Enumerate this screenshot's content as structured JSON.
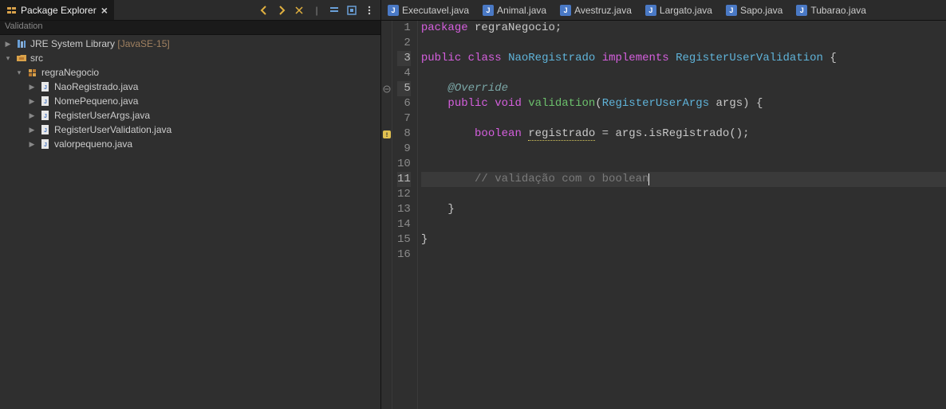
{
  "packageExplorer": {
    "title": "Package Explorer",
    "filterText": "Validation",
    "tree": {
      "jre": {
        "label": "JRE System Library",
        "extra": "[JavaSE-15]"
      },
      "src": {
        "label": "src"
      },
      "pkg": {
        "label": "regraNegocio"
      },
      "files": [
        "NaoRegistrado.java",
        "NomePequeno.java",
        "RegisterUserArgs.java",
        "RegisterUserValidation.java",
        "valorpequeno.java"
      ]
    }
  },
  "editorTabs": [
    "Executavel.java",
    "Animal.java",
    "Avestruz.java",
    "Largato.java",
    "Sapo.java",
    "Tubarao.java"
  ],
  "code": {
    "pkg_kw": "package",
    "pkg_name": "regraNegocio",
    "semi": ";",
    "public": "public",
    "class": "class",
    "implements": "implements",
    "void": "void",
    "boolean": "boolean",
    "NaoRegistrado": "NaoRegistrado",
    "RegisterUserValidation": "RegisterUserValidation",
    "Override": "@Override",
    "validation": "validation",
    "RegisterUserArgs": "RegisterUserArgs",
    "args": "args",
    "registrado": "registrado",
    "isRegistrado": "isRegistrado",
    "comment": "// validação com o boolean",
    "lb": "{",
    "rb": "}",
    "lp": "(",
    "rp": ")",
    "eq": " = ",
    "dot": ".",
    "empty_parens": "()"
  },
  "lineNumbers": [
    "1",
    "2",
    "3",
    "4",
    "5",
    "6",
    "7",
    "8",
    "9",
    "10",
    "11",
    "12",
    "13",
    "14",
    "15",
    "16"
  ]
}
